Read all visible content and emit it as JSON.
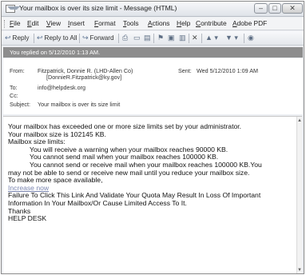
{
  "window": {
    "title": "Your mailbox is over its size limit - Message (HTML)",
    "min_glyph": "–",
    "max_glyph": "□",
    "close_glyph": "✕"
  },
  "menu": {
    "items": [
      "File",
      "Edit",
      "View",
      "Insert",
      "Format",
      "Tools",
      "Actions",
      "Help",
      "Contribute",
      "Adobe PDF"
    ]
  },
  "toolbar": {
    "reply": "Reply",
    "reply_all": "Reply to All",
    "forward": "Forward"
  },
  "info_bar": "You replied on 5/12/2010 1:13 AM.",
  "header": {
    "from_label": "From:",
    "from_value_line1": "Fitzpatrick, Donnie R. (LHD-Allen Co)",
    "from_value_line2": "[DonnieR.Fitzpatrick@ky.gov]",
    "sent_label": "Sent:",
    "sent_value": "Wed 5/12/2010 1:09 AM",
    "to_label": "To:",
    "to_value": "info@helpdesk.org",
    "cc_label": "Cc:",
    "cc_value": "",
    "subject_label": "Subject:",
    "subject_value": "Your mailbox is over its size limit"
  },
  "body": {
    "line1": "Your mailbox has exceeded one or more size limits set by your administrator.",
    "line2": "Your mailbox size is 102145 KB.",
    "line3": "Mailbox size limits:",
    "line4": "You will receive a warning when your mailbox reaches 90000 KB.",
    "line5": "You cannot send mail when your mailbox reaches 100000 KB.",
    "line6": "You cannot send or receive mail when your mailbox reaches 100000 KB.You",
    "line7": "may not be able to send or receive new mail until you reduce your mailbox size.",
    "line8": "To make more space available,",
    "link": "Increase now",
    "line9": "Failure To Click This Link And Validate Your Quota May Result In Loss Of Important",
    "line10": "Information In Your Mailbox/Or Cause Limited Access To It.",
    "line11": "Thanks",
    "line12": "HELP DESK"
  },
  "icons": {
    "scroll_up": "▲",
    "scroll_down": "▼"
  }
}
